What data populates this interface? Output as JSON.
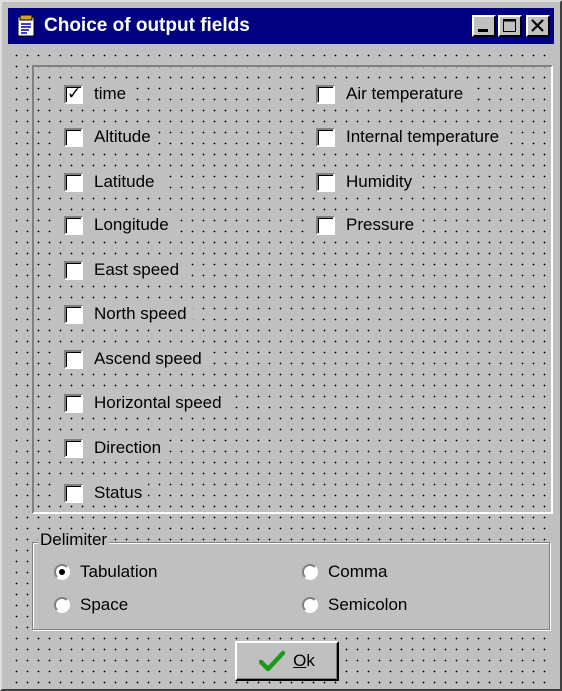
{
  "window": {
    "title": "Choice of output fields"
  },
  "fields_left": [
    {
      "label": "time",
      "checked": true
    },
    {
      "label": "Altitude",
      "checked": false
    },
    {
      "label": "Latitude",
      "checked": false
    },
    {
      "label": "Longitude",
      "checked": false
    },
    {
      "label": "East speed",
      "checked": false
    },
    {
      "label": "North speed",
      "checked": false
    },
    {
      "label": "Ascend speed",
      "checked": false
    },
    {
      "label": "Horizontal speed",
      "checked": false
    },
    {
      "label": "Direction",
      "checked": false
    },
    {
      "label": "Status",
      "checked": false
    }
  ],
  "fields_right": [
    {
      "label": "Air temperature",
      "checked": false
    },
    {
      "label": "Internal temperature",
      "checked": false
    },
    {
      "label": "Humidity",
      "checked": false
    },
    {
      "label": "Pressure",
      "checked": false
    }
  ],
  "delimiter": {
    "legend": "Delimiter",
    "options": [
      {
        "label": "Tabulation",
        "selected": true
      },
      {
        "label": "Comma",
        "selected": false
      },
      {
        "label": "Space",
        "selected": false
      },
      {
        "label": "Semicolon",
        "selected": false
      }
    ]
  },
  "ok_button": {
    "accel": "O",
    "rest": "k"
  },
  "colors": {
    "titlebar": "#000080",
    "face": "#c0c0c0",
    "ok_check": "#1a9a1a"
  }
}
